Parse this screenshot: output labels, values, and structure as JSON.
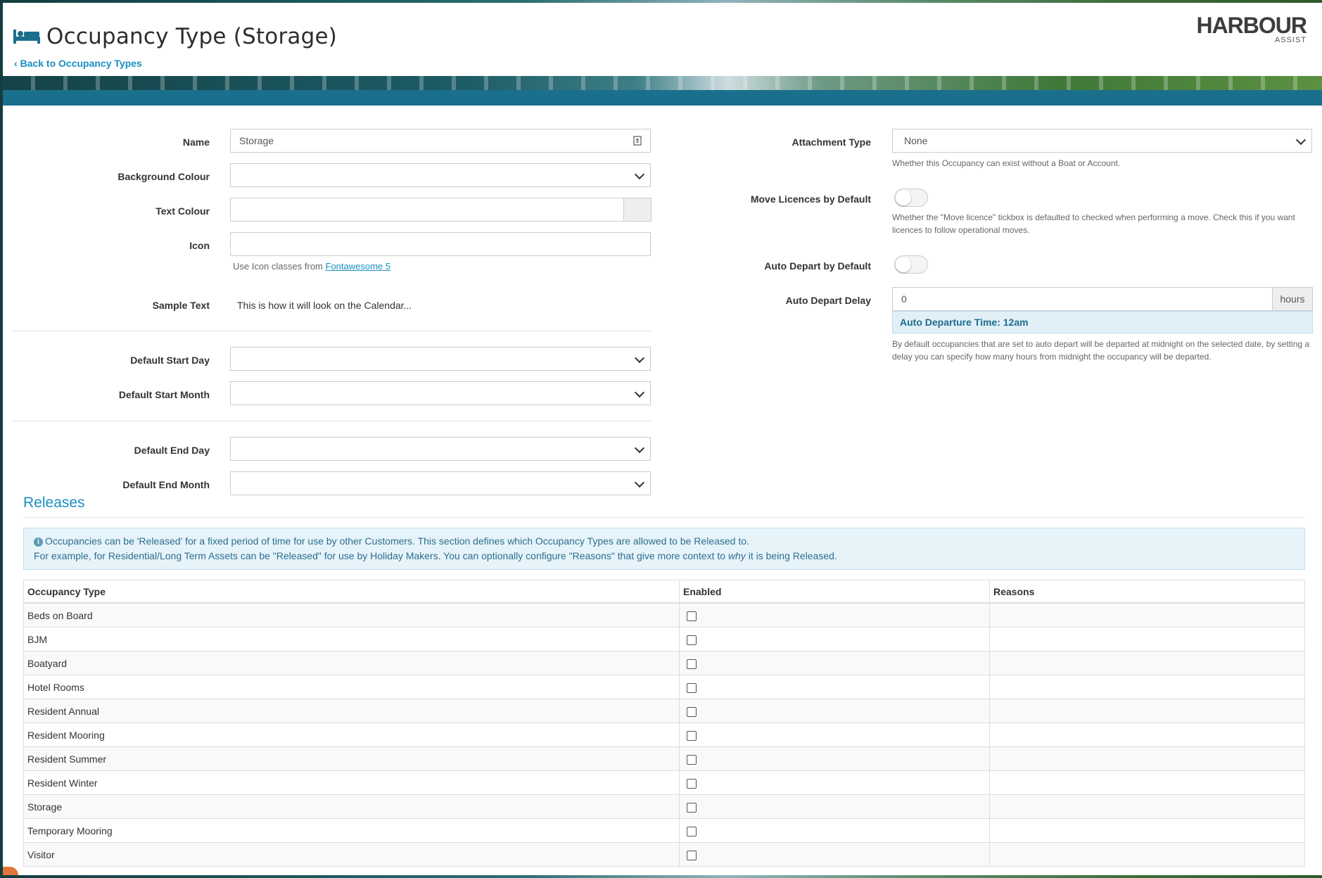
{
  "header": {
    "title": "Occupancy Type (Storage)",
    "back_link": "Back to Occupancy Types",
    "logo_main": "HARBOUR",
    "logo_sub": "ASSIST",
    "title_icon": "bed-icon"
  },
  "form": {
    "name": {
      "label": "Name",
      "value": "Storage"
    },
    "background_colour": {
      "label": "Background Colour",
      "value": ""
    },
    "text_colour": {
      "label": "Text Colour",
      "value": ""
    },
    "icon": {
      "label": "Icon",
      "value": "",
      "help_prefix": "Use Icon classes from ",
      "help_link": "Fontawesome 5"
    },
    "sample_text": {
      "label": "Sample Text",
      "value": "This is how it will look on the Calendar..."
    },
    "default_start_day": {
      "label": "Default Start Day",
      "value": ""
    },
    "default_start_month": {
      "label": "Default Start Month",
      "value": ""
    },
    "default_end_day": {
      "label": "Default End Day",
      "value": ""
    },
    "default_end_month": {
      "label": "Default End Month",
      "value": ""
    },
    "attachment_type": {
      "label": "Attachment Type",
      "value": "None",
      "help": "Whether this Occupancy can exist without a Boat or Account."
    },
    "move_licences": {
      "label": "Move Licences by Default",
      "checked": false,
      "help": "Whether the \"Move licence\" tickbox is defaulted to checked when performing a move. Check this if you want licences to follow operational moves."
    },
    "auto_depart": {
      "label": "Auto Depart by Default",
      "checked": false
    },
    "auto_depart_delay": {
      "label": "Auto Depart Delay",
      "value": "0",
      "unit": "hours",
      "info": "Auto Departure Time: 12am",
      "help": "By default occupancies that are set to auto depart will be departed at midnight on the selected date, by setting a delay you can specify how many hours from midnight the occupancy will be departed."
    }
  },
  "releases": {
    "title": "Releases",
    "info_line1": "Occupancies can be 'Released' for a fixed period of time for use by other Customers. This section defines which Occupancy Types are allowed to be Released to.",
    "info_line2_pre": "For example, for Residential/Long Term Assets can be \"Released\" for use by Holiday Makers. You can optionally configure \"Reasons\" that give more context to ",
    "info_line2_em": "why",
    "info_line2_post": " it is being Released.",
    "columns": [
      "Occupancy Type",
      "Enabled",
      "Reasons"
    ],
    "rows": [
      {
        "type": "Beds on Board",
        "enabled": false,
        "reasons": ""
      },
      {
        "type": "BJM",
        "enabled": false,
        "reasons": ""
      },
      {
        "type": "Boatyard",
        "enabled": false,
        "reasons": ""
      },
      {
        "type": "Hotel Rooms",
        "enabled": false,
        "reasons": ""
      },
      {
        "type": "Resident Annual",
        "enabled": false,
        "reasons": ""
      },
      {
        "type": "Resident Mooring",
        "enabled": false,
        "reasons": ""
      },
      {
        "type": "Resident Summer",
        "enabled": false,
        "reasons": ""
      },
      {
        "type": "Resident Winter",
        "enabled": false,
        "reasons": ""
      },
      {
        "type": "Storage",
        "enabled": false,
        "reasons": ""
      },
      {
        "type": "Temporary Mooring",
        "enabled": false,
        "reasons": ""
      },
      {
        "type": "Visitor",
        "enabled": false,
        "reasons": ""
      }
    ]
  },
  "colors": {
    "accent": "#1a8fc1",
    "header_bar": "#1a6f8c"
  }
}
